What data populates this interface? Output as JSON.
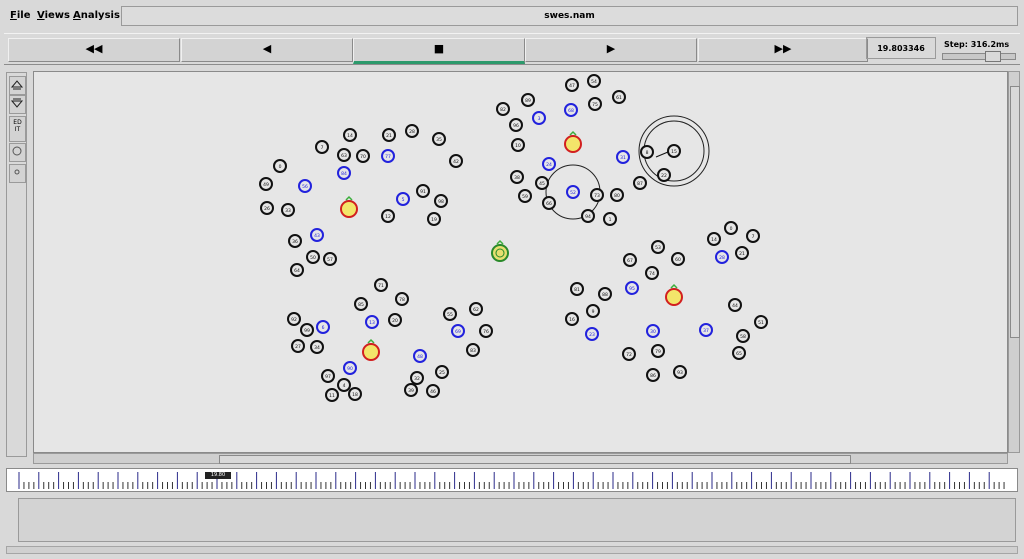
{
  "menu": [
    {
      "id": "file",
      "label": "File"
    },
    {
      "id": "views",
      "label": "Views"
    },
    {
      "id": "analysis",
      "label": "Analysis"
    }
  ],
  "window_title": "swes.nam",
  "playback": {
    "rewind": "◀◀",
    "back": "◀",
    "stop": "■",
    "play": "▶",
    "fast_forward": "▶▶"
  },
  "time_value": "19.803346",
  "step_label": "Step: 316.2ms",
  "step_slider_level": 0.75,
  "tools": [
    {
      "id": "zoom-in",
      "icon": "zoom-in-icon",
      "label": ""
    },
    {
      "id": "zoom-out",
      "icon": "zoom-out-icon",
      "label": ""
    },
    {
      "id": "edit",
      "icon": "edit-icon",
      "label": "ED IT"
    },
    {
      "id": "circle",
      "icon": "circle-icon",
      "label": ""
    },
    {
      "id": "small-circle",
      "icon": "dot-icon",
      "label": ""
    }
  ],
  "colors": {
    "normal_node": "#111111",
    "blue_node": "#2222dd",
    "head_fill": "#f3e56a",
    "head_ring": "#d21f1f",
    "sink_fill": "#e6df70",
    "sink_ring": "#2a8a2a",
    "active_tab": "#2c9a6c"
  },
  "timeline_marker": "19.80"
}
